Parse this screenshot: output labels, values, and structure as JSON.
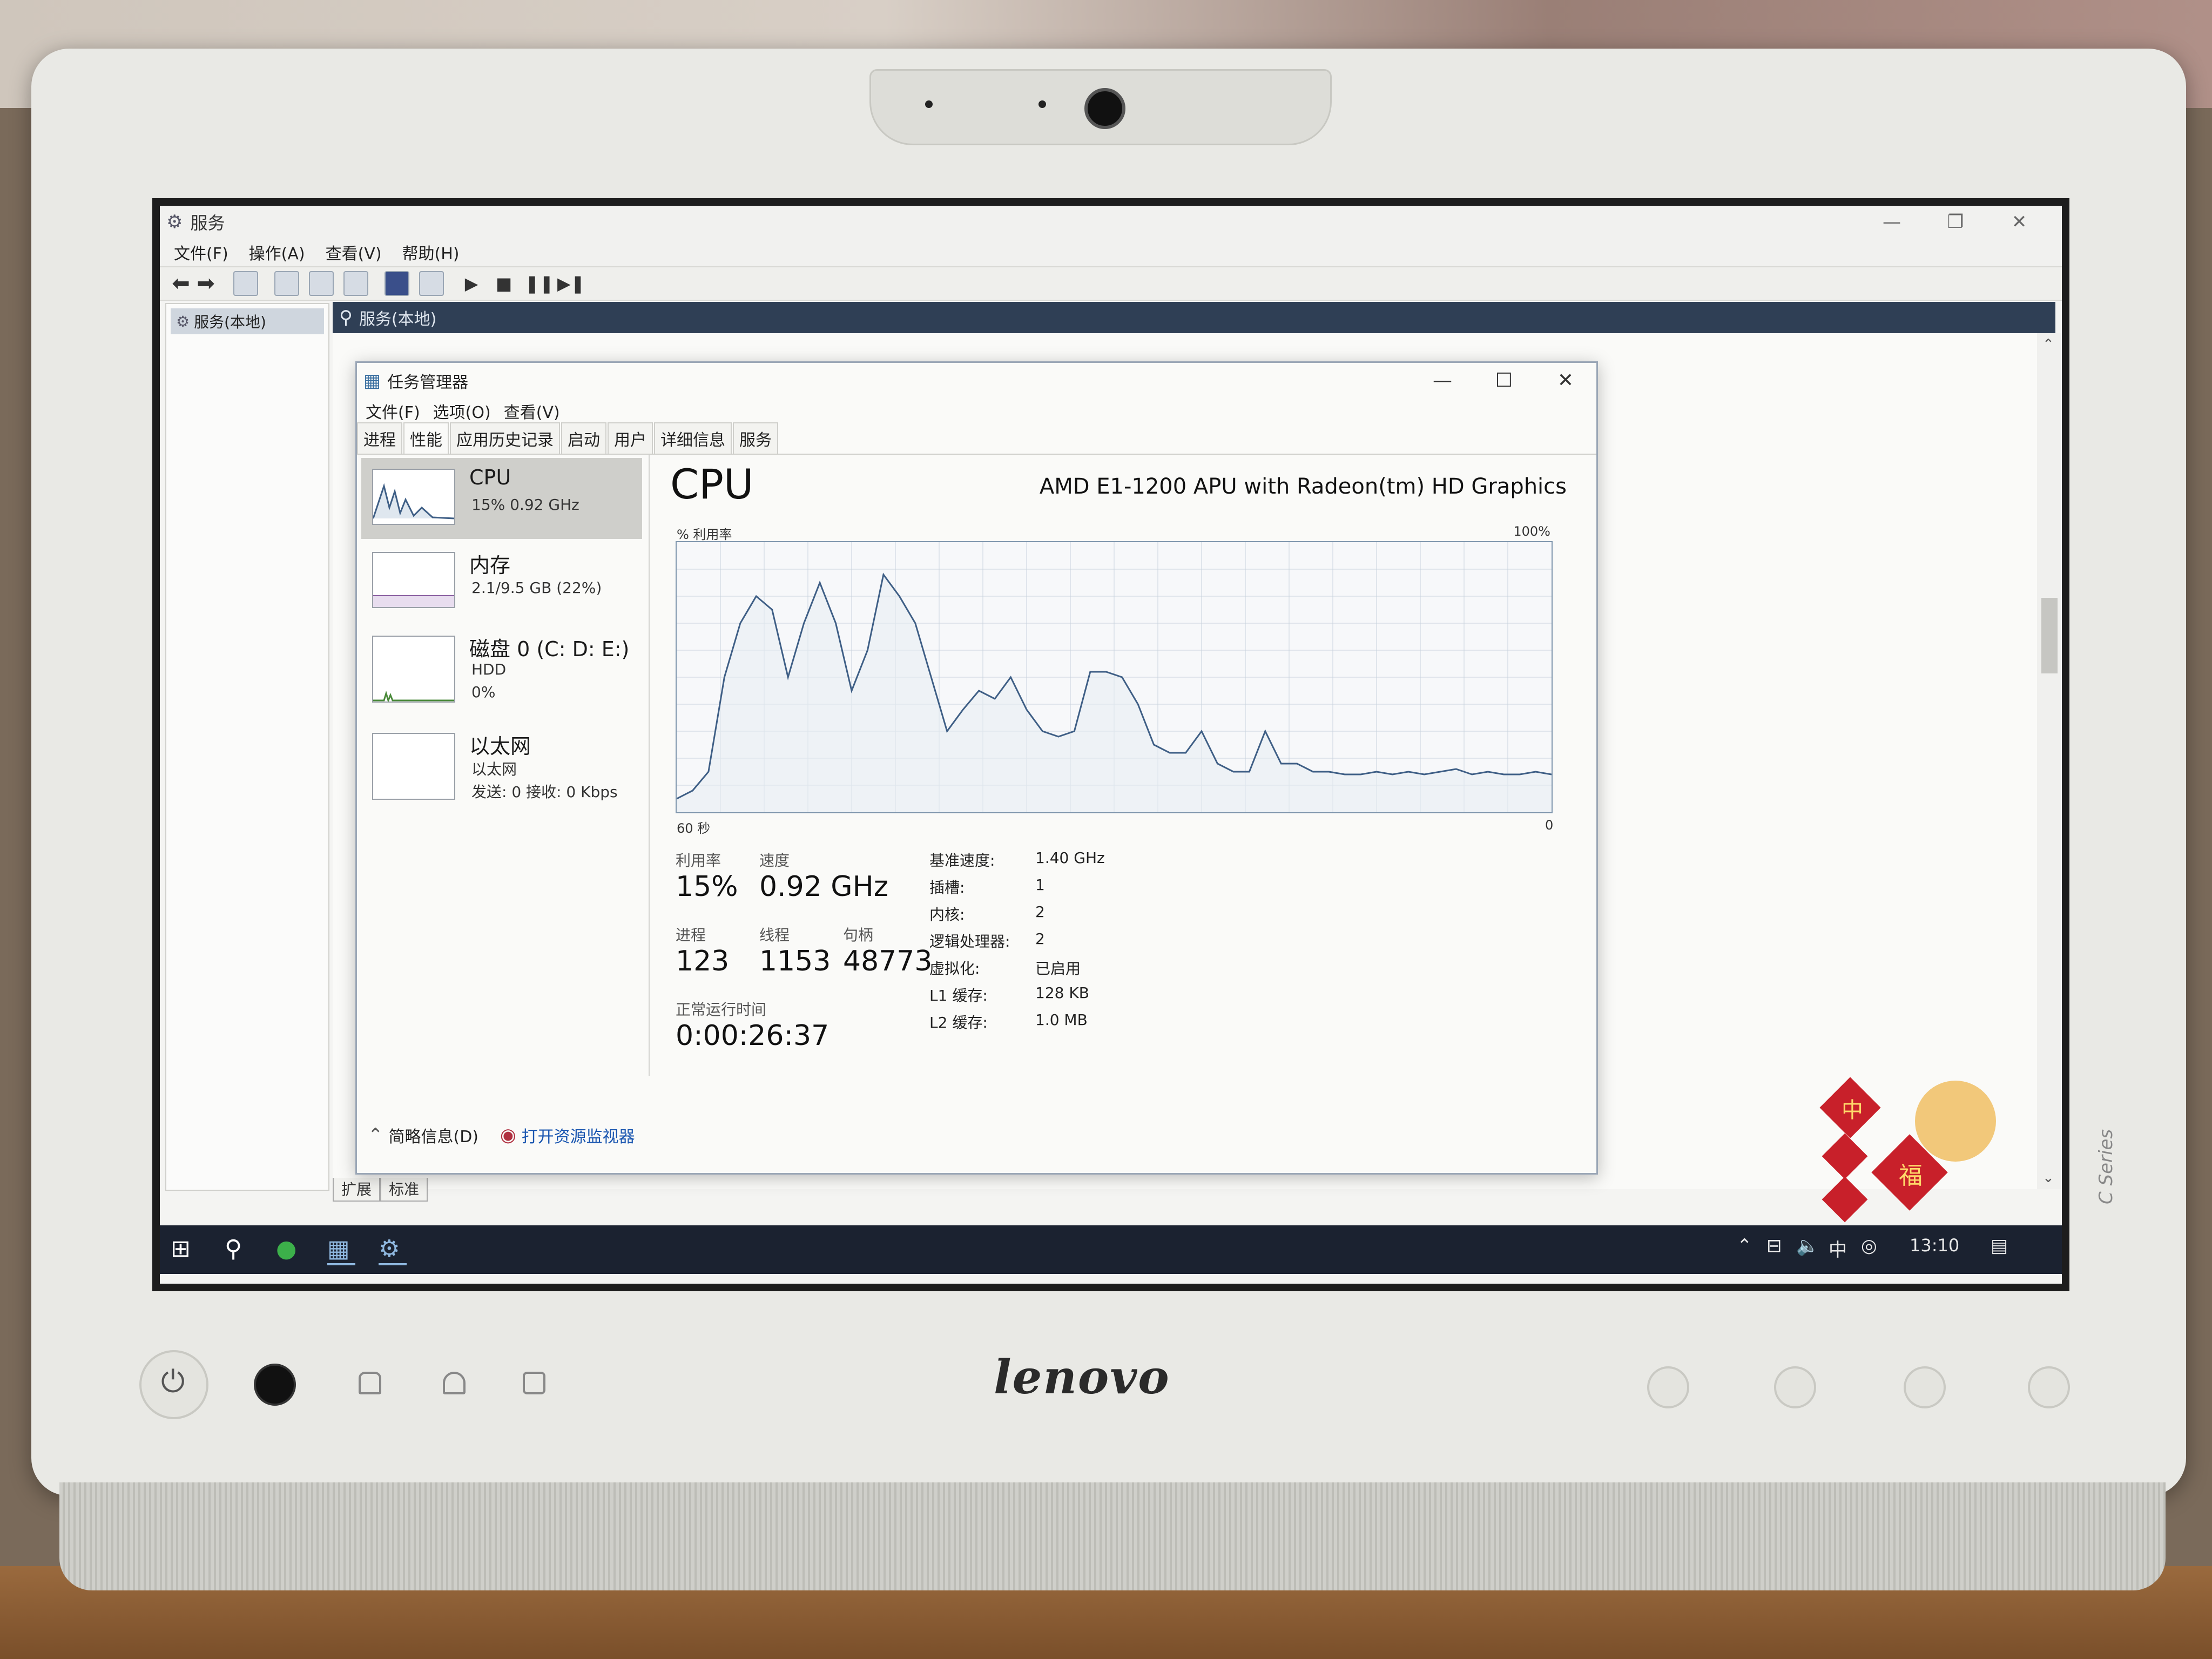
{
  "services": {
    "title": "服务",
    "menu": [
      "文件(F)",
      "操作(A)",
      "查看(V)",
      "帮助(H)"
    ],
    "tree_root": "服务(本地)",
    "header": "服务(本地)",
    "bottom_tabs": [
      "扩展",
      "标准"
    ]
  },
  "taskmgr": {
    "title": "任务管理器",
    "menu": [
      "文件(F)",
      "选项(O)",
      "查看(V)"
    ],
    "tabs": [
      "进程",
      "性能",
      "应用历史记录",
      "启动",
      "用户",
      "详细信息",
      "服务"
    ],
    "active_tab": "性能",
    "sidebar": [
      {
        "name": "CPU",
        "sub1": "15% 0.92 GHz",
        "sub2": "",
        "sub3": ""
      },
      {
        "name": "内存",
        "sub1": "2.1/9.5 GB (22%)",
        "sub2": "",
        "sub3": ""
      },
      {
        "name": "磁盘 0 (C: D: E:)",
        "sub1": "HDD",
        "sub2": "0%",
        "sub3": ""
      },
      {
        "name": "以太网",
        "sub1": "以太网",
        "sub2": "发送: 0 接收: 0 Kbps",
        "sub3": ""
      }
    ],
    "cpu": {
      "title": "CPU",
      "model": "AMD E1-1200 APU with Radeon(tm) HD Graphics",
      "util_label": "% 利用率",
      "max_label": "100%",
      "time_left": "60 秒",
      "time_right": "0",
      "stats": {
        "util_lbl": "利用率",
        "util": "15%",
        "speed_lbl": "速度",
        "speed": "0.92 GHz",
        "proc_lbl": "进程",
        "proc": "123",
        "thread_lbl": "线程",
        "thread": "1153",
        "handle_lbl": "句柄",
        "handle": "48773",
        "uptime_lbl": "正常运行时间",
        "uptime": "0:00:26:37"
      },
      "specs": [
        {
          "k": "基准速度:",
          "v": "1.40 GHz"
        },
        {
          "k": "插槽:",
          "v": "1"
        },
        {
          "k": "内核:",
          "v": "2"
        },
        {
          "k": "逻辑处理器:",
          "v": "2"
        },
        {
          "k": "虚拟化:",
          "v": "已启用"
        },
        {
          "k": "L1 缓存:",
          "v": "128 KB"
        },
        {
          "k": "L2 缓存:",
          "v": "1.0 MB"
        }
      ]
    },
    "footer": {
      "brief": "简略信息(D)",
      "resmon": "打开资源监视器"
    }
  },
  "chart_data": {
    "type": "line",
    "ylabel": "% 利用率",
    "ylim": [
      0,
      100
    ],
    "x_range_seconds": [
      60,
      0
    ],
    "values": [
      5,
      8,
      15,
      50,
      70,
      80,
      75,
      50,
      70,
      85,
      70,
      45,
      60,
      88,
      80,
      70,
      50,
      30,
      38,
      45,
      42,
      50,
      38,
      30,
      28,
      30,
      52,
      52,
      50,
      40,
      25,
      22,
      22,
      30,
      18,
      15,
      15,
      30,
      18,
      18,
      15,
      15,
      14,
      14,
      15,
      14,
      15,
      14,
      15,
      16,
      14,
      15,
      14,
      14,
      15,
      14
    ]
  },
  "taskbar": {
    "clock": "13:10",
    "ime": "中"
  },
  "device": {
    "brand": "lenovo",
    "series": "C Series"
  },
  "sticker": {
    "chars": [
      "中",
      "福"
    ]
  },
  "colors": {
    "graph_line": "#3f5f86",
    "graph_grid": "#c8d2dd",
    "graph_fill": "#e8eef4"
  }
}
